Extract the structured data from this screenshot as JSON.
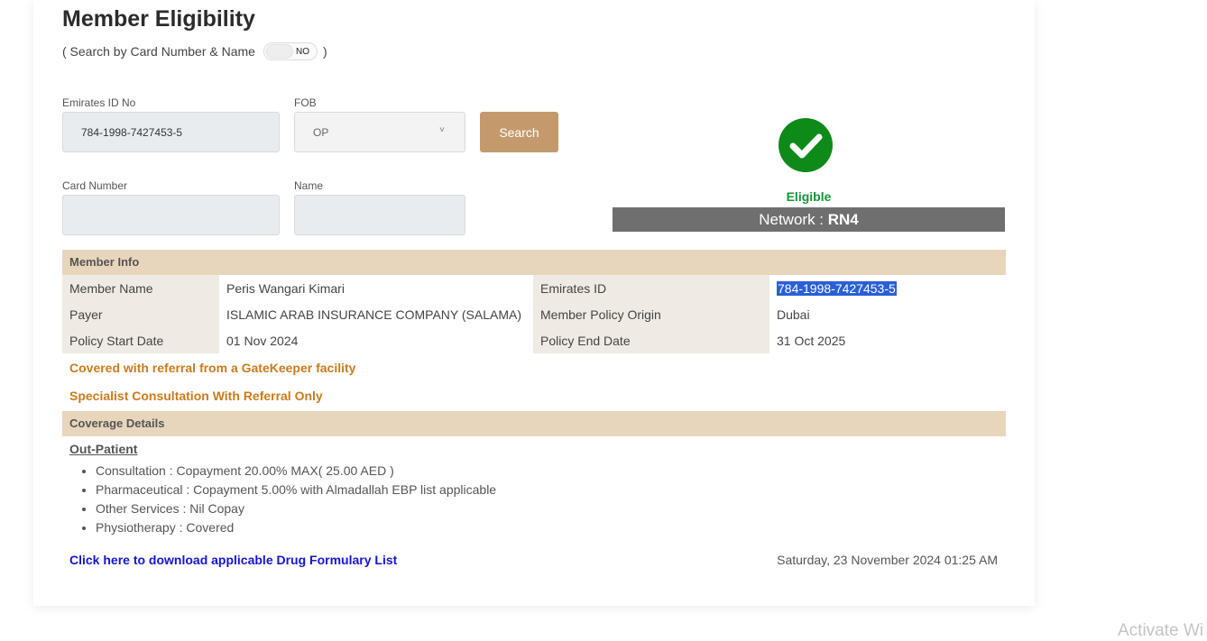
{
  "page": {
    "title": "Member Eligibility",
    "search_toggle_prefix": "( Search by Card Number & Name",
    "search_toggle_value": "NO",
    "search_toggle_suffix": ")"
  },
  "form": {
    "emirates_id_label": "Emirates ID No",
    "emirates_id_value": "784-1998-7427453-5",
    "fob_label": "FOB",
    "fob_value": "OP",
    "search_label": "Search",
    "card_number_label": "Card Number",
    "card_number_value": "",
    "name_label": "Name",
    "name_value": ""
  },
  "status": {
    "eligibility": "Eligible",
    "network_prefix": "Network : ",
    "network_value": "RN4"
  },
  "member_info": {
    "section_title": "Member Info",
    "rows": [
      {
        "k1": "Member Name",
        "v1": "Peris Wangari Kimari",
        "k2": "Emirates ID",
        "v2": "784-1998-7427453-5"
      },
      {
        "k1": "Payer",
        "v1": "ISLAMIC ARAB INSURANCE COMPANY (SALAMA)",
        "k2": "Member Policy Origin",
        "v2": "Dubai"
      },
      {
        "k1": "Policy Start Date",
        "v1": "01 Nov 2024",
        "k2": "Policy End Date",
        "v2": "31 Oct 2025"
      }
    ]
  },
  "notices": {
    "gatekeeper": "Covered with referral from a GateKeeper facility",
    "specialist": "Specialist Consultation With Referral Only"
  },
  "coverage": {
    "section_title": "Coverage Details",
    "outpatient_label": "Out-Patient",
    "items": [
      "Consultation : Copayment 20.00% MAX( 25.00 AED )",
      "Pharmaceutical : Copayment 5.00% with Almadallah EBP list applicable",
      "Other Services : Nil Copay",
      "Physiotherapy : Covered"
    ]
  },
  "footer": {
    "drug_link": "Click here to download applicable Drug Formulary List",
    "datetime": "Saturday, 23 November 2024 01:25 AM"
  },
  "os_overlay": {
    "watermark": "Activate Wi"
  },
  "colors": {
    "accent": "#c49a6c",
    "section_header_bg": "#e8d6bc",
    "eligible_green": "#14933a",
    "notice_orange": "#cc7a1b",
    "link_blue": "#1414d6",
    "network_bar": "#6f6f6f"
  },
  "icons": {
    "eligibility_status": "check-circle-icon",
    "fob_dropdown": "chevron-down-icon"
  }
}
